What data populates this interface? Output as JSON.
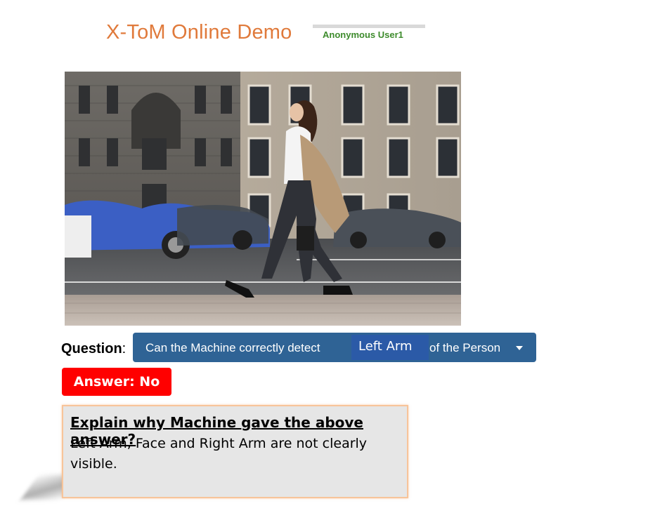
{
  "header": {
    "app_title": "X-ToM Online Demo",
    "user_name": "Anonymous User1"
  },
  "colors": {
    "title": "#e07a3b",
    "user": "#3d8b2c",
    "dropdown_bg": "#2f6395",
    "answer_bg": "#ff0000",
    "explain_border": "#f7c49a"
  },
  "image": {
    "icon": "photo-woman-walking-street"
  },
  "question": {
    "label": "Question",
    "colon": ":",
    "prefix": "Can the Machine correctly detect",
    "selected_part": "Left Arm",
    "suffix": "of the Person"
  },
  "answer": {
    "label": "Answer: No"
  },
  "explanation": {
    "heading": "Explain why Machine gave the above answer?",
    "text": "Left Arm, Face and Right Arm are not clearly visible."
  }
}
